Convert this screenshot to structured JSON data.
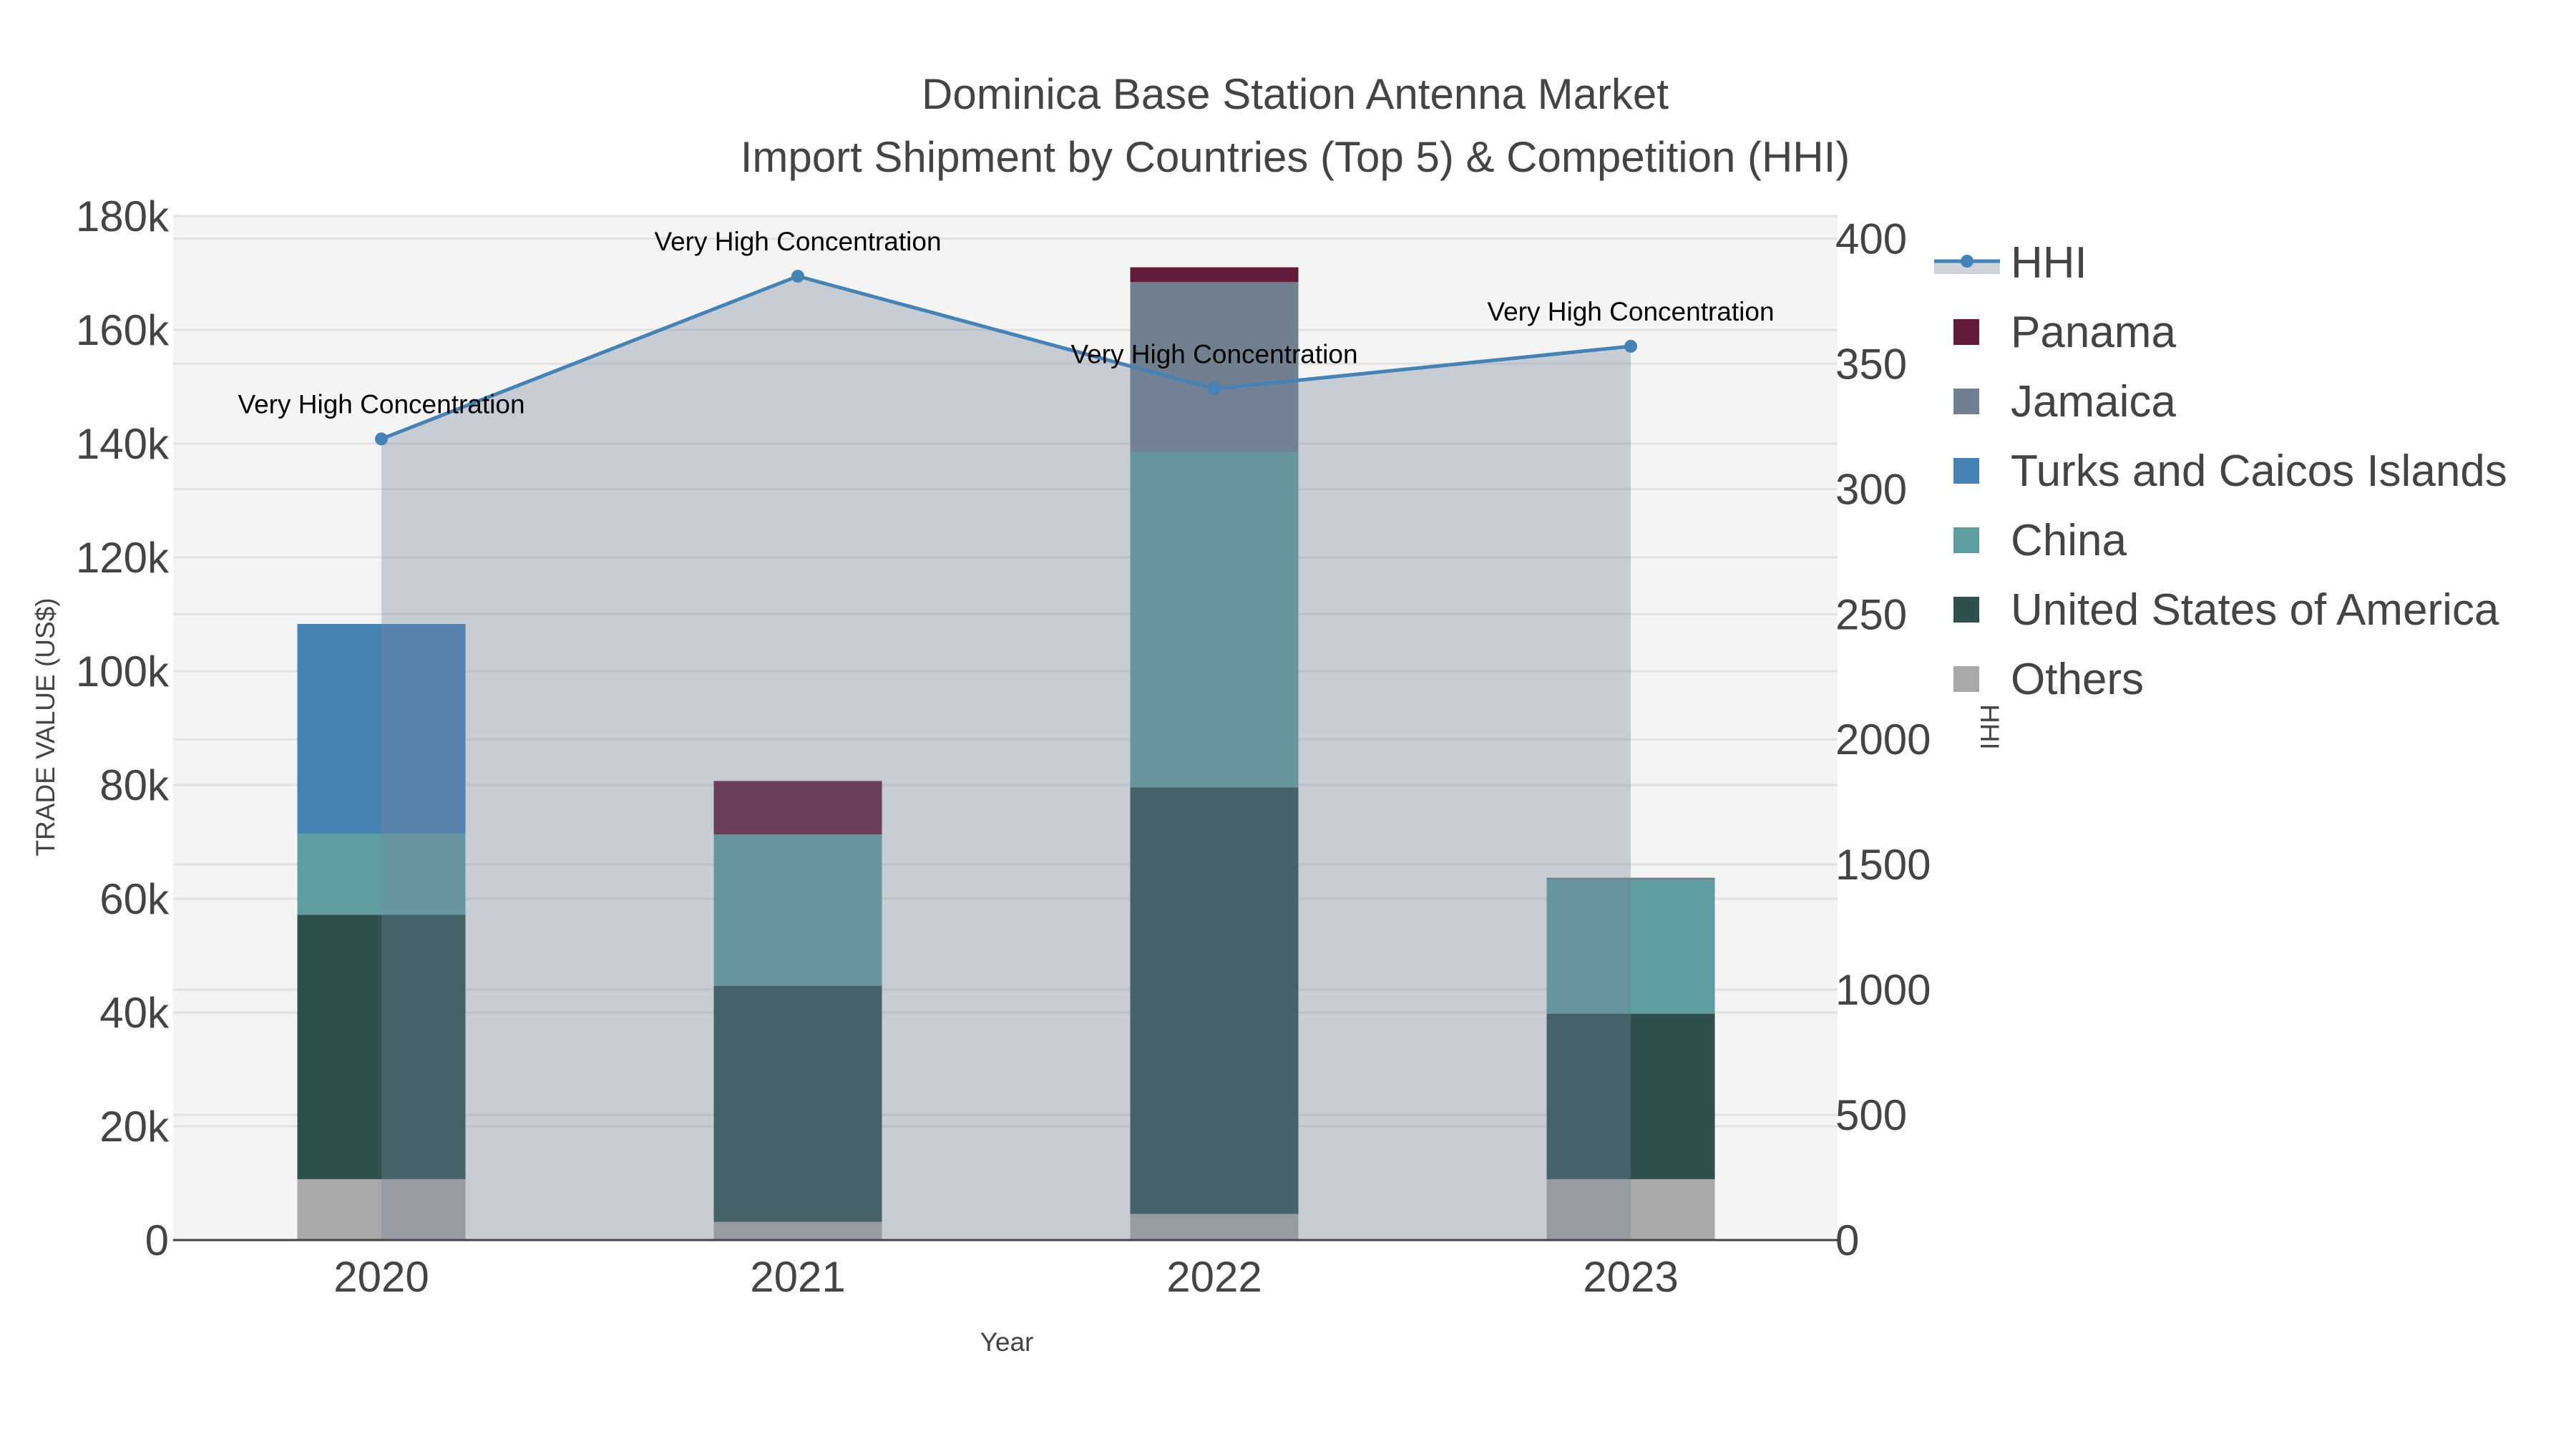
{
  "chart_data": {
    "type": "bar",
    "title": "Dominica Base Station Antenna Market",
    "subtitle": "Import Shipment by Countries (Top 5) & Competition (HHI)",
    "xlabel": "Year",
    "ylabel": "TRADE VALUE (US$)",
    "y2label": "HHI",
    "categories": [
      "2020",
      "2021",
      "2022",
      "2023"
    ],
    "barmode": "stack",
    "ylim": [
      0,
      180000
    ],
    "yticks": [
      0,
      20000,
      40000,
      60000,
      80000,
      100000,
      120000,
      140000,
      160000,
      180000
    ],
    "ytick_labels": [
      "0",
      "20k",
      "40k",
      "60k",
      "80k",
      "100k",
      "120k",
      "140k",
      "160k",
      "180k"
    ],
    "y2lim": [
      0,
      4090
    ],
    "y2ticks": [
      0,
      500,
      1000,
      1500,
      2000,
      2500,
      3000,
      3500,
      4000
    ],
    "y2tick_labels": [
      "0",
      "500",
      "1000",
      "1500",
      "2000",
      "250",
      "300",
      "350",
      "400"
    ],
    "grid": true,
    "legend_placement": "right",
    "series": [
      {
        "name": "Others",
        "color": "#a9a9a9",
        "values": [
          10700,
          3200,
          4600,
          10700
        ]
      },
      {
        "name": "United States of America",
        "color": "#2f4f4f",
        "values": [
          46500,
          41500,
          75000,
          29100
        ]
      },
      {
        "name": "China",
        "color": "#5f9ea0",
        "values": [
          14200,
          26600,
          58900,
          23500
        ]
      },
      {
        "name": "Turks and Caicos Islands",
        "color": "#4682b4",
        "values": [
          36900,
          0,
          0,
          0
        ]
      },
      {
        "name": "Jamaica",
        "color": "#708090",
        "values": [
          0,
          0,
          29900,
          400
        ]
      },
      {
        "name": "Panama",
        "color": "#641a3a",
        "values": [
          0,
          9400,
          2600,
          0
        ]
      }
    ],
    "line": {
      "name": "HHI",
      "color": "#4682b4",
      "axis": "right",
      "fill": "tozeroy",
      "values": [
        3200,
        3850,
        3400,
        3570
      ],
      "annotations": [
        "Very High Concentration",
        "Very High Concentration",
        "Very High Concentration",
        "Very High Concentration"
      ]
    },
    "legend_order": [
      "HHI",
      "Panama",
      "Jamaica",
      "Turks and Caicos Islands",
      "China",
      "United States of America",
      "Others"
    ]
  }
}
